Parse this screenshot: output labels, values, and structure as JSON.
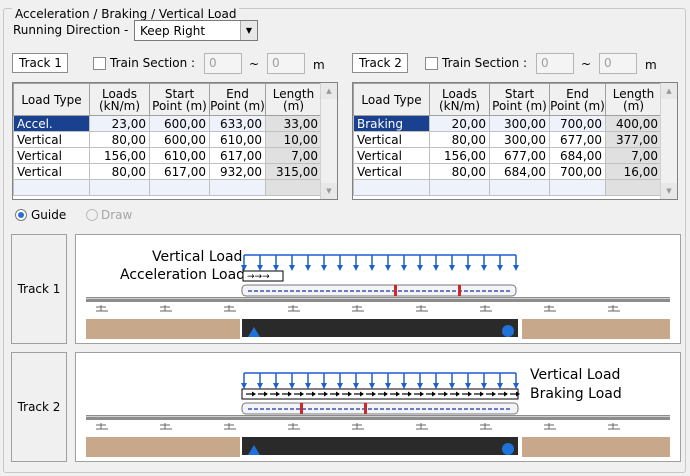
{
  "group_title": "Acceleration / Braking / Vertical Load",
  "running_direction": {
    "label": "Running Direction -",
    "value": "Keep Right"
  },
  "tracks": [
    {
      "name": "Track 1",
      "train_section": {
        "label": "Train Section :",
        "from": "0",
        "tilde": "~",
        "to": "0",
        "unit": "m"
      },
      "columns": [
        "Load Type",
        "Loads (kN/m)",
        "Start Point (m)",
        "End Point (m)",
        "Length (m)"
      ],
      "rows": [
        {
          "type": "Accel.",
          "load": "23,00",
          "start": "600,00",
          "end": "633,00",
          "length": "33,00"
        },
        {
          "type": "Vertical",
          "load": "80,00",
          "start": "600,00",
          "end": "610,00",
          "length": "10,00"
        },
        {
          "type": "Vertical",
          "load": "156,00",
          "start": "610,00",
          "end": "617,00",
          "length": "7,00"
        },
        {
          "type": "Vertical",
          "load": "80,00",
          "start": "617,00",
          "end": "932,00",
          "length": "315,00"
        }
      ]
    },
    {
      "name": "Track 2",
      "train_section": {
        "label": "Train Section :",
        "from": "0",
        "tilde": "~",
        "to": "0",
        "unit": "m"
      },
      "columns": [
        "Load Type",
        "Loads (kN/m)",
        "Start Point (m)",
        "End Point (m)",
        "Length (m)"
      ],
      "rows": [
        {
          "type": "Braking",
          "load": "20,00",
          "start": "300,00",
          "end": "700,00",
          "length": "400,00"
        },
        {
          "type": "Vertical",
          "load": "80,00",
          "start": "300,00",
          "end": "677,00",
          "length": "377,00"
        },
        {
          "type": "Vertical",
          "load": "156,00",
          "start": "677,00",
          "end": "684,00",
          "length": "7,00"
        },
        {
          "type": "Vertical",
          "load": "80,00",
          "start": "684,00",
          "end": "700,00",
          "length": "16,00"
        }
      ]
    }
  ],
  "view_mode": {
    "guide": "Guide",
    "draw": "Draw",
    "selected": "Guide"
  },
  "diagrams": [
    {
      "label": "Track 1",
      "vertical_load": "Vertical Load",
      "horizontal_load": "Acceleration Load",
      "horizontal_direction": "right"
    },
    {
      "label": "Track 2",
      "vertical_load": "Vertical Load",
      "horizontal_load": "Braking Load",
      "horizontal_direction": "right"
    }
  ],
  "colors": {
    "selection": "#19418f",
    "arrow_blue": "#1f5fd0",
    "ground": "#c8a88a",
    "train_red": "#cc2a2a"
  }
}
